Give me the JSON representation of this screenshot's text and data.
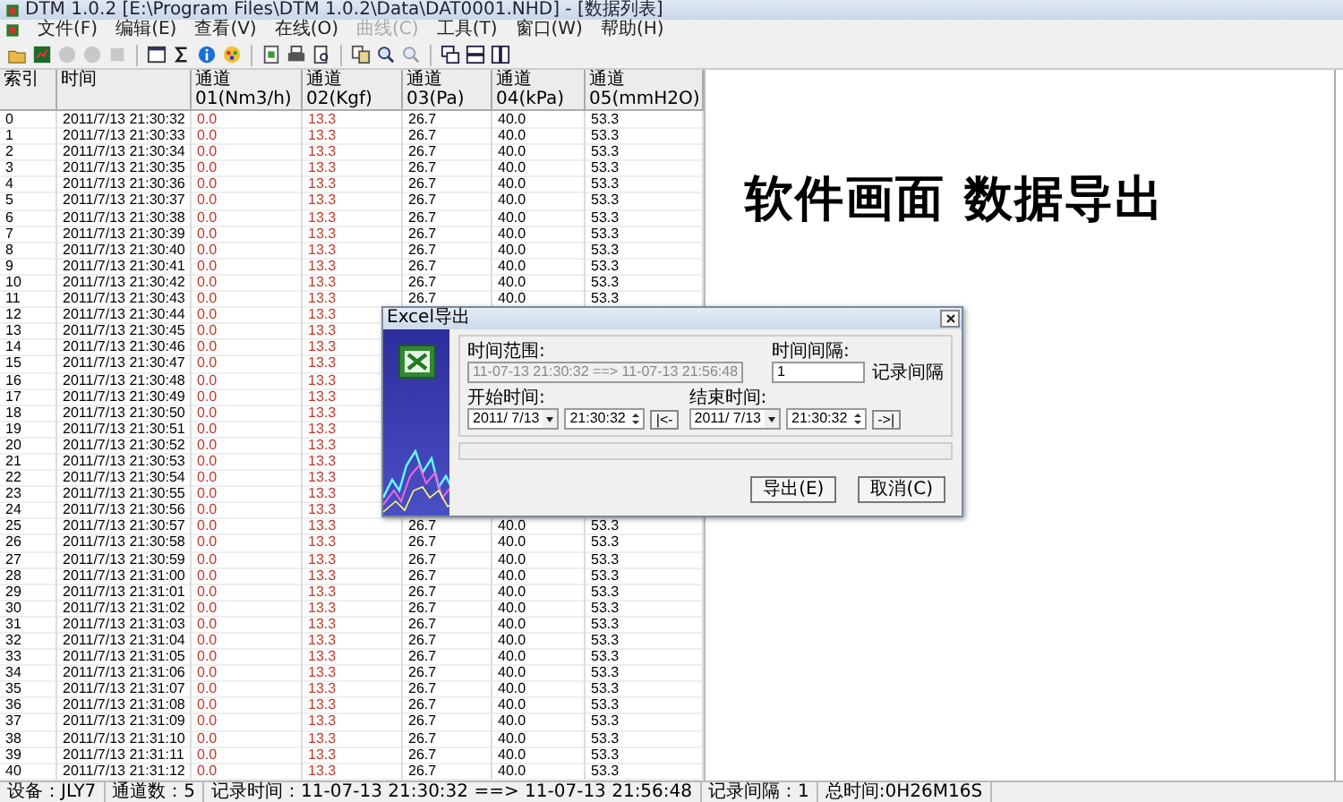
{
  "window": {
    "title": "DTM 1.0.2 [E:\\Program Files\\DTM 1.0.2\\Data\\DAT0001.NHD] - [数据列表]"
  },
  "menu": [
    {
      "label": "文件(F)",
      "disabled": false
    },
    {
      "label": "编辑(E)",
      "disabled": false
    },
    {
      "label": "查看(V)",
      "disabled": false
    },
    {
      "label": "在线(O)",
      "disabled": false
    },
    {
      "label": "曲线(C)",
      "disabled": true
    },
    {
      "label": "工具(T)",
      "disabled": false
    },
    {
      "label": "窗口(W)",
      "disabled": false
    },
    {
      "label": "帮助(H)",
      "disabled": false
    }
  ],
  "toolbar": [
    {
      "kind": "open",
      "disabled": false
    },
    {
      "kind": "device",
      "disabled": false
    },
    {
      "kind": "record",
      "disabled": true
    },
    {
      "kind": "record",
      "disabled": true
    },
    {
      "kind": "stop",
      "disabled": true
    },
    {
      "kind": "sep"
    },
    {
      "kind": "window",
      "disabled": false
    },
    {
      "kind": "sigma",
      "disabled": false
    },
    {
      "kind": "info",
      "disabled": false
    },
    {
      "kind": "palette",
      "disabled": false
    },
    {
      "kind": "sep"
    },
    {
      "kind": "export",
      "disabled": false
    },
    {
      "kind": "print",
      "disabled": false
    },
    {
      "kind": "preview",
      "disabled": false
    },
    {
      "kind": "sep"
    },
    {
      "kind": "copy",
      "disabled": false
    },
    {
      "kind": "zoom",
      "disabled": false
    },
    {
      "kind": "zoom",
      "disabled": true
    },
    {
      "kind": "sep"
    },
    {
      "kind": "cascade",
      "disabled": false
    },
    {
      "kind": "tile-h",
      "disabled": false
    },
    {
      "kind": "tile-v",
      "disabled": false
    }
  ],
  "table": {
    "columns": [
      {
        "label": "索引",
        "color": "#000000"
      },
      {
        "label": "时间",
        "color": "#000000"
      },
      {
        "label": "通道01(Nm3/h)",
        "color": "#c0392b"
      },
      {
        "label": "通道02(Kgf)",
        "color": "#c0392b"
      },
      {
        "label": "通道03(Pa)",
        "color": "#000000"
      },
      {
        "label": "通道04(kPa)",
        "color": "#000000"
      },
      {
        "label": "通道05(mmH2O)",
        "color": "#000000"
      }
    ],
    "rows": [
      {
        "cells": [
          "0",
          "2011/7/13 21:30:32",
          "0.0",
          "13.3",
          "26.7",
          "40.0",
          "53.3"
        ]
      },
      {
        "cells": [
          "1",
          "2011/7/13 21:30:33",
          "0.0",
          "13.3",
          "26.7",
          "40.0",
          "53.3"
        ]
      },
      {
        "cells": [
          "2",
          "2011/7/13 21:30:34",
          "0.0",
          "13.3",
          "26.7",
          "40.0",
          "53.3"
        ]
      },
      {
        "cells": [
          "3",
          "2011/7/13 21:30:35",
          "0.0",
          "13.3",
          "26.7",
          "40.0",
          "53.3"
        ]
      },
      {
        "cells": [
          "4",
          "2011/7/13 21:30:36",
          "0.0",
          "13.3",
          "26.7",
          "40.0",
          "53.3"
        ]
      },
      {
        "cells": [
          "5",
          "2011/7/13 21:30:37",
          "0.0",
          "13.3",
          "26.7",
          "40.0",
          "53.3"
        ]
      },
      {
        "cells": [
          "6",
          "2011/7/13 21:30:38",
          "0.0",
          "13.3",
          "26.7",
          "40.0",
          "53.3"
        ]
      },
      {
        "cells": [
          "7",
          "2011/7/13 21:30:39",
          "0.0",
          "13.3",
          "26.7",
          "40.0",
          "53.3"
        ]
      },
      {
        "cells": [
          "8",
          "2011/7/13 21:30:40",
          "0.0",
          "13.3",
          "26.7",
          "40.0",
          "53.3"
        ]
      },
      {
        "cells": [
          "9",
          "2011/7/13 21:30:41",
          "0.0",
          "13.3",
          "26.7",
          "40.0",
          "53.3"
        ]
      },
      {
        "cells": [
          "10",
          "2011/7/13 21:30:42",
          "0.0",
          "13.3",
          "26.7",
          "40.0",
          "53.3"
        ]
      },
      {
        "cells": [
          "11",
          "2011/7/13 21:30:43",
          "0.0",
          "13.3",
          "26.7",
          "40.0",
          "53.3"
        ]
      },
      {
        "cells": [
          "12",
          "2011/7/13 21:30:44",
          "0.0",
          "13.3"
        ]
      },
      {
        "cells": [
          "13",
          "2011/7/13 21:30:45",
          "0.0",
          "13.3"
        ]
      },
      {
        "cells": [
          "14",
          "2011/7/13 21:30:46",
          "0.0",
          "13.3"
        ]
      },
      {
        "cells": [
          "15",
          "2011/7/13 21:30:47",
          "0.0",
          "13.3"
        ]
      },
      {
        "cells": [
          "16",
          "2011/7/13 21:30:48",
          "0.0",
          "13.3"
        ]
      },
      {
        "cells": [
          "17",
          "2011/7/13 21:30:49",
          "0.0",
          "13.3"
        ]
      },
      {
        "cells": [
          "18",
          "2011/7/13 21:30:50",
          "0.0",
          "13.3"
        ]
      },
      {
        "cells": [
          "19",
          "2011/7/13 21:30:51",
          "0.0",
          "13.3"
        ]
      },
      {
        "cells": [
          "20",
          "2011/7/13 21:30:52",
          "0.0",
          "13.3"
        ]
      },
      {
        "cells": [
          "21",
          "2011/7/13 21:30:53",
          "0.0",
          "13.3"
        ]
      },
      {
        "cells": [
          "22",
          "2011/7/13 21:30:54",
          "0.0",
          "13.3"
        ]
      },
      {
        "cells": [
          "23",
          "2011/7/13 21:30:55",
          "0.0",
          "13.3"
        ]
      },
      {
        "cells": [
          "24",
          "2011/7/13 21:30:56",
          "0.0",
          "13.3"
        ]
      },
      {
        "cells": [
          "25",
          "2011/7/13 21:30:57",
          "0.0",
          "13.3",
          "26.7",
          "40.0",
          "53.3"
        ]
      },
      {
        "cells": [
          "26",
          "2011/7/13 21:30:58",
          "0.0",
          "13.3",
          "26.7",
          "40.0",
          "53.3"
        ]
      },
      {
        "cells": [
          "27",
          "2011/7/13 21:30:59",
          "0.0",
          "13.3",
          "26.7",
          "40.0",
          "53.3"
        ]
      },
      {
        "cells": [
          "28",
          "2011/7/13 21:31:00",
          "0.0",
          "13.3",
          "26.7",
          "40.0",
          "53.3"
        ]
      },
      {
        "cells": [
          "29",
          "2011/7/13 21:31:01",
          "0.0",
          "13.3",
          "26.7",
          "40.0",
          "53.3"
        ]
      },
      {
        "cells": [
          "30",
          "2011/7/13 21:31:02",
          "0.0",
          "13.3",
          "26.7",
          "40.0",
          "53.3"
        ]
      },
      {
        "cells": [
          "31",
          "2011/7/13 21:31:03",
          "0.0",
          "13.3",
          "26.7",
          "40.0",
          "53.3"
        ]
      },
      {
        "cells": [
          "32",
          "2011/7/13 21:31:04",
          "0.0",
          "13.3",
          "26.7",
          "40.0",
          "53.3"
        ]
      },
      {
        "cells": [
          "33",
          "2011/7/13 21:31:05",
          "0.0",
          "13.3",
          "26.7",
          "40.0",
          "53.3"
        ]
      },
      {
        "cells": [
          "34",
          "2011/7/13 21:31:06",
          "0.0",
          "13.3",
          "26.7",
          "40.0",
          "53.3"
        ]
      },
      {
        "cells": [
          "35",
          "2011/7/13 21:31:07",
          "0.0",
          "13.3",
          "26.7",
          "40.0",
          "53.3"
        ]
      },
      {
        "cells": [
          "36",
          "2011/7/13 21:31:08",
          "0.0",
          "13.3",
          "26.7",
          "40.0",
          "53.3"
        ]
      },
      {
        "cells": [
          "37",
          "2011/7/13 21:31:09",
          "0.0",
          "13.3",
          "26.7",
          "40.0",
          "53.3"
        ]
      },
      {
        "cells": [
          "38",
          "2011/7/13 21:31:10",
          "0.0",
          "13.3",
          "26.7",
          "40.0",
          "53.3"
        ]
      },
      {
        "cells": [
          "39",
          "2011/7/13 21:31:11",
          "0.0",
          "13.3",
          "26.7",
          "40.0",
          "53.3"
        ]
      },
      {
        "cells": [
          "40",
          "2011/7/13 21:31:12",
          "0.0",
          "13.3",
          "26.7",
          "40.0",
          "53.3"
        ]
      }
    ]
  },
  "headline": "软件画面 数据导出",
  "dialog": {
    "title": "Excel导出",
    "range_label": "时间范围:",
    "range_value": "11-07-13 21:30:32 ==> 11-07-13 21:56:48",
    "interval_label": "时间间隔:",
    "interval_value": "1",
    "interval_unit": "记录间隔",
    "start_label": "开始时间:",
    "start_date": "2011/ 7/13",
    "start_time": "21:30:32",
    "start_button": "|<-",
    "end_label": "结束时间:",
    "end_date": "2011/ 7/13",
    "end_time": "21:30:32",
    "end_button": "->|",
    "buttons": [
      "导出(E)",
      "取消(C)"
    ]
  },
  "status_bar": [
    "设备：JLY7",
    "通道数：5",
    "记录时间：11-07-13 21:30:32 ==> 11-07-13 21:56:48",
    "记录间隔：1",
    "总时间:0H26M16S"
  ]
}
